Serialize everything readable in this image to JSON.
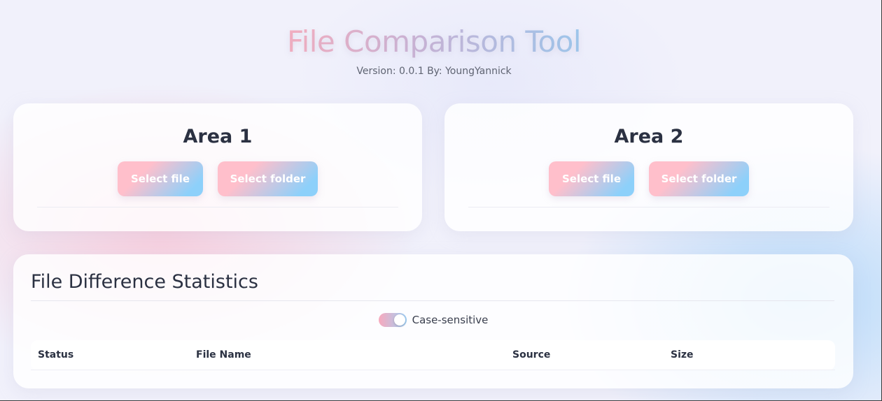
{
  "header": {
    "title": "File Comparison Tool",
    "version": "Version: 0.0.1 By: YoungYannick"
  },
  "areas": [
    {
      "title": "Area 1",
      "select_file_label": "Select file",
      "select_folder_label": "Select folder"
    },
    {
      "title": "Area 2",
      "select_file_label": "Select file",
      "select_folder_label": "Select folder"
    }
  ],
  "stats": {
    "title": "File Difference Statistics",
    "case_sensitive": {
      "label": "Case-sensitive",
      "checked": true
    },
    "table": {
      "columns": [
        "Status",
        "File Name",
        "Source",
        "Size"
      ],
      "rows": []
    }
  },
  "colors": {
    "button_gradient_start": "#ffbfcb",
    "button_gradient_end": "#8dd0fa",
    "title_gradient_start": "#f7aebf",
    "title_gradient_end": "#9cc8ee",
    "text_dark": "#2b3142"
  }
}
